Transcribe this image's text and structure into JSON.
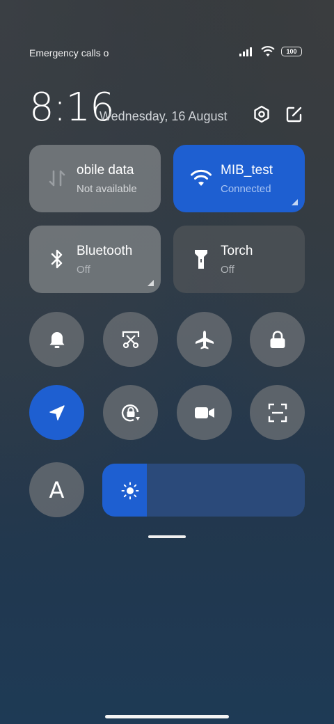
{
  "status_bar": {
    "carrier_text": "Emergency calls o",
    "battery": "100",
    "icons": [
      "signal-icon",
      "wifi-icon",
      "battery-icon"
    ]
  },
  "header": {
    "time": "8:16",
    "date": "Wednesday, 16 August",
    "buttons": [
      "settings-icon",
      "edit-icon"
    ]
  },
  "tiles": {
    "mobile_data": {
      "title": "obile data",
      "status": "Not available",
      "icon": "mobile-data-icon"
    },
    "wifi": {
      "title": "MIB_test",
      "status": "Connected",
      "icon": "wifi-icon"
    },
    "bluetooth": {
      "title": "Bluetooth",
      "status": "Off",
      "icon": "bluetooth-icon"
    },
    "torch": {
      "title": "Torch",
      "status": "Off",
      "icon": "torch-icon"
    }
  },
  "toggles": [
    {
      "name": "notification-bell",
      "icon": "bell-icon",
      "active": false
    },
    {
      "name": "screenshot",
      "icon": "scissors-icon",
      "active": false
    },
    {
      "name": "airplane-mode",
      "icon": "airplane-icon",
      "active": false
    },
    {
      "name": "lock-screen",
      "icon": "lock-icon",
      "active": false
    },
    {
      "name": "location",
      "icon": "location-arrow-icon",
      "active": true
    },
    {
      "name": "auto-rotate",
      "icon": "rotate-lock-icon",
      "active": false
    },
    {
      "name": "screen-record",
      "icon": "video-camera-icon",
      "active": false
    },
    {
      "name": "scanner",
      "icon": "scan-icon",
      "active": false
    }
  ],
  "font_toggle": {
    "label": "A"
  },
  "brightness": {
    "level": 0.22,
    "icon": "sun-icon"
  },
  "colors": {
    "accent": "#1e5fd1",
    "tile_gray": "#787c80",
    "brightness_track": "#2b4a7a"
  }
}
